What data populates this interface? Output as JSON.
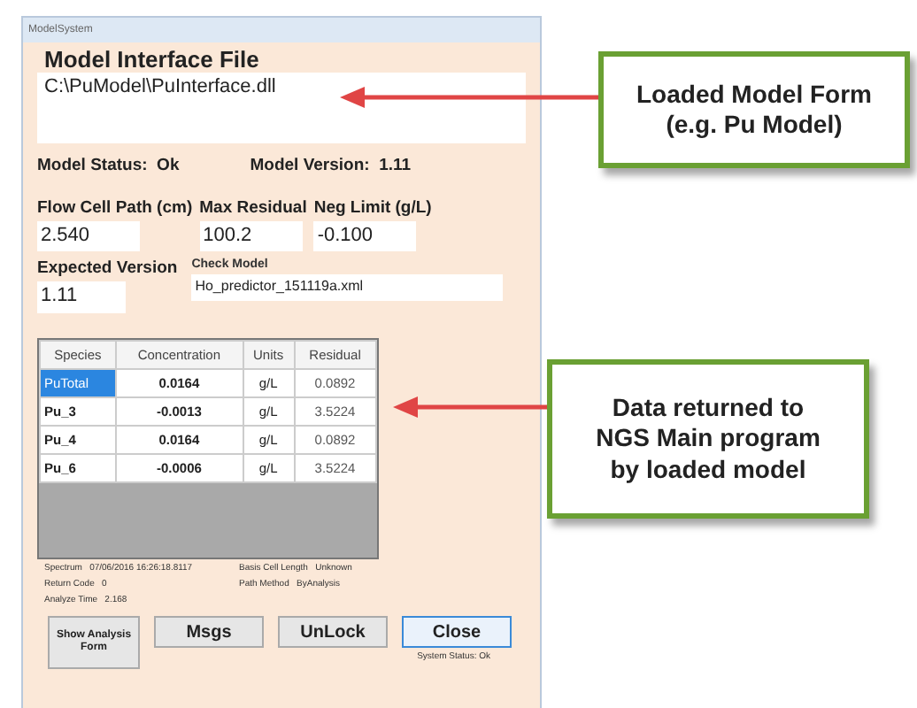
{
  "window": {
    "title": "ModelSystem"
  },
  "interface_file": {
    "label": "Model Interface File",
    "value": "C:\\PuModel\\PuInterface.dll"
  },
  "model_status": {
    "label": "Model Status:",
    "value": "Ok"
  },
  "model_version": {
    "label": "Model Version:",
    "value": "1.11"
  },
  "fields": [
    {
      "label": "Flow Cell Path (cm)",
      "value": "2.540"
    },
    {
      "label": "Max Residual",
      "value": "100.2"
    },
    {
      "label": "Neg Limit (g/L)",
      "value": "-0.100"
    }
  ],
  "expected_version": {
    "label": "Expected Version",
    "value": "1.11"
  },
  "check_model": {
    "label": "Check Model",
    "value": "Ho_predictor_151119a.xml"
  },
  "table": {
    "columns": [
      "Species",
      "Concentration",
      "Units",
      "Residual"
    ],
    "rows": [
      {
        "cells": [
          "PuTotal",
          "0.0164",
          "g/L",
          "0.0892"
        ],
        "selected": true
      },
      {
        "cells": [
          "Pu_3",
          "-0.0013",
          "g/L",
          "3.5224"
        ],
        "selected": false
      },
      {
        "cells": [
          "Pu_4",
          "0.0164",
          "g/L",
          "0.0892"
        ],
        "selected": false
      },
      {
        "cells": [
          "Pu_6",
          "-0.0006",
          "g/L",
          "3.5224"
        ],
        "selected": false
      }
    ]
  },
  "info": [
    [
      {
        "label": "Spectrum",
        "value": "07/06/2016 16:26:18.8117"
      },
      {
        "label": "Basis Cell Length",
        "value": "Unknown"
      }
    ],
    [
      {
        "label": "Return Code",
        "value": "0"
      },
      {
        "label": "Path Method",
        "value": "ByAnalysis"
      }
    ],
    [
      {
        "label": "Analyze Time",
        "value": "2.168"
      }
    ]
  ],
  "buttons": [
    {
      "label": "Show Analysis Form",
      "focused": false
    },
    {
      "label": "Msgs",
      "focused": false
    },
    {
      "label": "UnLock",
      "focused": false
    },
    {
      "label": "Close",
      "focused": true
    }
  ],
  "system_status": "System Status: Ok",
  "callouts": [
    {
      "lines": [
        "Loaded Model Form",
        "(e.g. Pu Model)"
      ]
    },
    {
      "lines": [
        "Data returned to",
        "NGS Main program",
        "by loaded model"
      ]
    }
  ]
}
